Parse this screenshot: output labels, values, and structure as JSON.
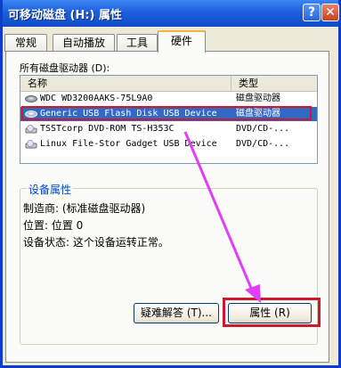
{
  "window": {
    "title": "可移动磁盘 (H:) 属性",
    "help_glyph": "?",
    "close_glyph": "✕"
  },
  "tabs": [
    {
      "label": "常规",
      "active": false
    },
    {
      "label": "自动播放",
      "active": false
    },
    {
      "label": "工具",
      "active": false
    },
    {
      "label": "硬件",
      "active": true
    }
  ],
  "devices": {
    "label": "所有磁盘驱动器 (D):",
    "columns": {
      "name": "名称",
      "type": "类型"
    },
    "rows": [
      {
        "name": "WDC WD3200AAKS-75L9A0",
        "type": "磁盘驱动器",
        "icon": "hard-disk-icon",
        "selected": false
      },
      {
        "name": "Generic USB Flash Disk USB Device",
        "type": "磁盘驱动器",
        "icon": "usb-disk-icon",
        "selected": true
      },
      {
        "name": "TSSTcorp DVD-ROM TS-H353C",
        "type": "DVD/CD-...",
        "icon": "dvd-drive-icon",
        "selected": false
      },
      {
        "name": "Linux File-Stor Gadget USB Device",
        "type": "DVD/CD-...",
        "icon": "dvd-drive-icon",
        "selected": false
      }
    ]
  },
  "properties": {
    "title": "设备属性",
    "manufacturer": "制造商: (标准磁盘驱动器)",
    "location": "位置: 位置 0",
    "status": "设备状态: 这个设备运转正常。"
  },
  "buttons": {
    "troubleshoot": "疑难解答 (T)...",
    "properties": "属性 (R)"
  },
  "colors": {
    "titlebar": "#0f4dc9",
    "selection": "#316ac5",
    "annotation_box": "#d0182a",
    "annotation_arrow": "#e040fb"
  }
}
